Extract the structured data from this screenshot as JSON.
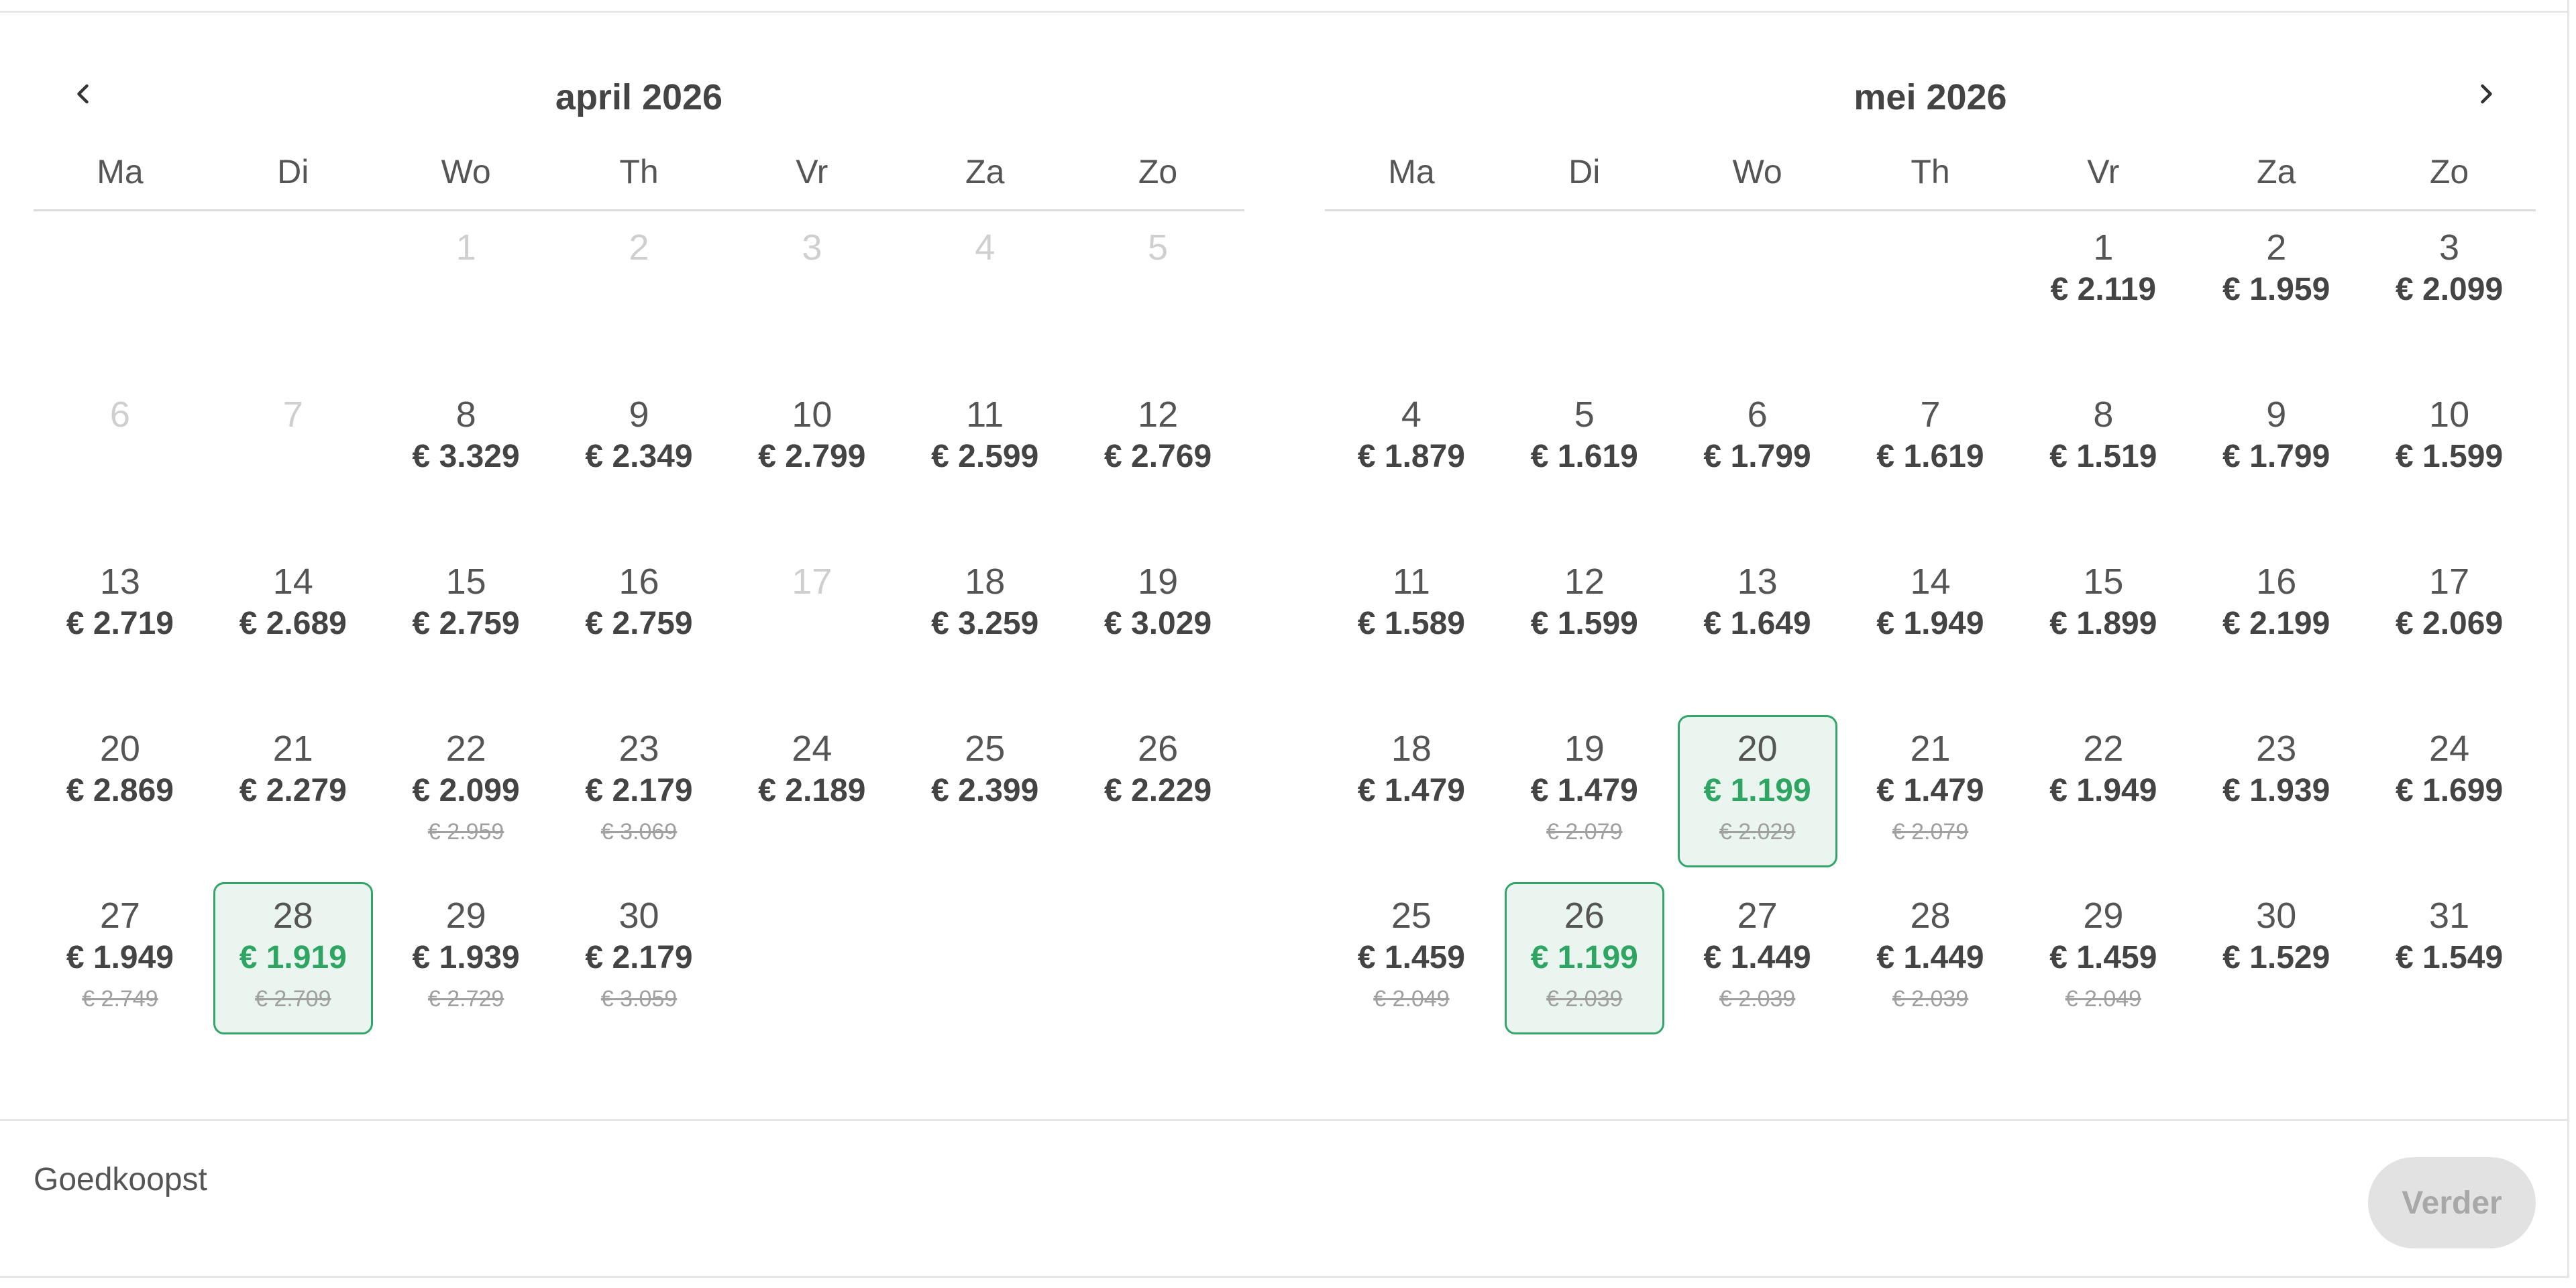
{
  "calendar": {
    "weekdays": [
      "Ma",
      "Di",
      "Wo",
      "Th",
      "Vr",
      "Za",
      "Zo"
    ],
    "months": [
      {
        "title": "april 2026",
        "leading_blanks": 2,
        "days": [
          {
            "n": "1",
            "disabled": true
          },
          {
            "n": "2",
            "disabled": true
          },
          {
            "n": "3",
            "disabled": true
          },
          {
            "n": "4",
            "disabled": true
          },
          {
            "n": "5",
            "disabled": true
          },
          {
            "n": "6",
            "disabled": true
          },
          {
            "n": "7",
            "disabled": true
          },
          {
            "n": "8",
            "price": "€ 3.329"
          },
          {
            "n": "9",
            "price": "€ 2.349"
          },
          {
            "n": "10",
            "price": "€ 2.799"
          },
          {
            "n": "11",
            "price": "€ 2.599"
          },
          {
            "n": "12",
            "price": "€ 2.769"
          },
          {
            "n": "13",
            "price": "€ 2.719"
          },
          {
            "n": "14",
            "price": "€ 2.689"
          },
          {
            "n": "15",
            "price": "€ 2.759"
          },
          {
            "n": "16",
            "price": "€ 2.759"
          },
          {
            "n": "17",
            "disabled": true
          },
          {
            "n": "18",
            "price": "€ 3.259"
          },
          {
            "n": "19",
            "price": "€ 3.029"
          },
          {
            "n": "20",
            "price": "€ 2.869"
          },
          {
            "n": "21",
            "price": "€ 2.279"
          },
          {
            "n": "22",
            "price": "€ 2.099",
            "old": "€ 2.959"
          },
          {
            "n": "23",
            "price": "€ 2.179",
            "old": "€ 3.069"
          },
          {
            "n": "24",
            "price": "€ 2.189"
          },
          {
            "n": "25",
            "price": "€ 2.399"
          },
          {
            "n": "26",
            "price": "€ 2.229"
          },
          {
            "n": "27",
            "price": "€ 1.949",
            "old": "€ 2.749"
          },
          {
            "n": "28",
            "price": "€ 1.919",
            "old": "€ 2.709",
            "cheapest": true
          },
          {
            "n": "29",
            "price": "€ 1.939",
            "old": "€ 2.729"
          },
          {
            "n": "30",
            "price": "€ 2.179",
            "old": "€ 3.059"
          }
        ]
      },
      {
        "title": "mei 2026",
        "leading_blanks": 4,
        "days": [
          {
            "n": "1",
            "price": "€ 2.119"
          },
          {
            "n": "2",
            "price": "€ 1.959"
          },
          {
            "n": "3",
            "price": "€ 2.099"
          },
          {
            "n": "4",
            "price": "€ 1.879"
          },
          {
            "n": "5",
            "price": "€ 1.619"
          },
          {
            "n": "6",
            "price": "€ 1.799"
          },
          {
            "n": "7",
            "price": "€ 1.619"
          },
          {
            "n": "8",
            "price": "€ 1.519"
          },
          {
            "n": "9",
            "price": "€ 1.799"
          },
          {
            "n": "10",
            "price": "€ 1.599"
          },
          {
            "n": "11",
            "price": "€ 1.589"
          },
          {
            "n": "12",
            "price": "€ 1.599"
          },
          {
            "n": "13",
            "price": "€ 1.649"
          },
          {
            "n": "14",
            "price": "€ 1.949"
          },
          {
            "n": "15",
            "price": "€ 1.899"
          },
          {
            "n": "16",
            "price": "€ 2.199"
          },
          {
            "n": "17",
            "price": "€ 2.069"
          },
          {
            "n": "18",
            "price": "€ 1.479"
          },
          {
            "n": "19",
            "price": "€ 1.479",
            "old": "€ 2.079"
          },
          {
            "n": "20",
            "price": "€ 1.199",
            "old": "€ 2.029",
            "cheapest": true
          },
          {
            "n": "21",
            "price": "€ 1.479",
            "old": "€ 2.079"
          },
          {
            "n": "22",
            "price": "€ 1.949"
          },
          {
            "n": "23",
            "price": "€ 1.939"
          },
          {
            "n": "24",
            "price": "€ 1.699"
          },
          {
            "n": "25",
            "price": "€ 1.459",
            "old": "€ 2.049"
          },
          {
            "n": "26",
            "price": "€ 1.199",
            "old": "€ 2.039",
            "cheapest": true
          },
          {
            "n": "27",
            "price": "€ 1.449",
            "old": "€ 2.039"
          },
          {
            "n": "28",
            "price": "€ 1.449",
            "old": "€ 2.039"
          },
          {
            "n": "29",
            "price": "€ 1.459",
            "old": "€ 2.049"
          },
          {
            "n": "30",
            "price": "€ 1.529"
          },
          {
            "n": "31",
            "price": "€ 1.549"
          }
        ]
      }
    ]
  },
  "footer": {
    "label": "Goedkoopst",
    "continue_label": "Verder"
  },
  "icons": {
    "prev": "chevron-left-icon",
    "next": "chevron-right-icon"
  },
  "colors": {
    "accent": "#2fa563",
    "selected_bg": "#e9f5ee",
    "disabled": "#cfcfcf"
  }
}
